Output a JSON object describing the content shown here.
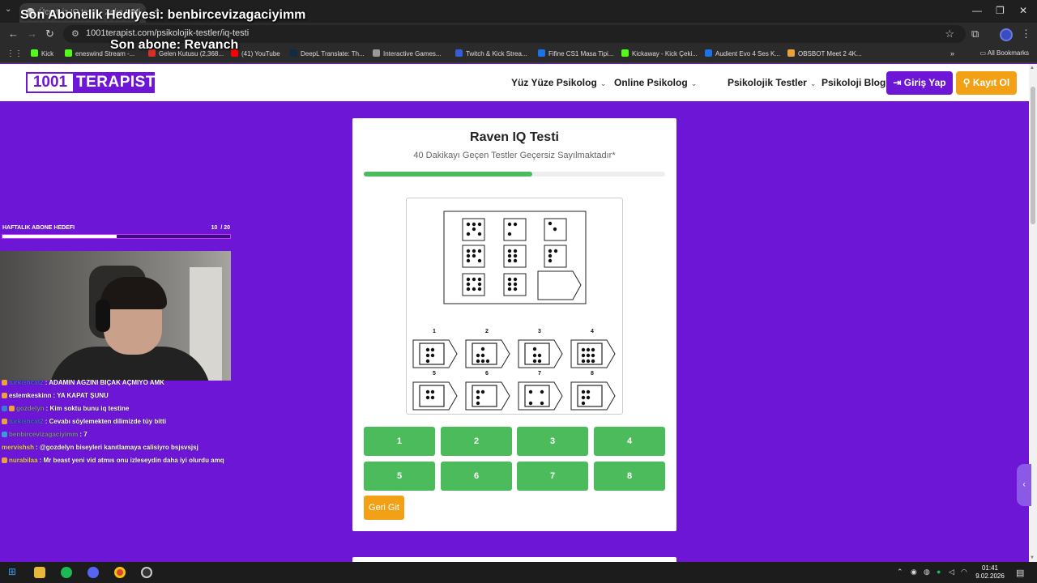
{
  "browser": {
    "tab_title": "Ücretsiz IQ testi – Zeka testi",
    "url": "1001terapist.com/psikolojik-testler/iq-testi",
    "all_bookmarks": "All Bookmarks",
    "bookmarks": [
      {
        "label": "Kick",
        "color": "#53fc18"
      },
      {
        "label": "eneswind Stream -...",
        "color": "#53fc18"
      },
      {
        "label": "Gelen Kutusu (2,368...",
        "color": "#d93025"
      },
      {
        "label": "(41) YouTube",
        "color": "#ff0000"
      },
      {
        "label": "DeepL Translate: Th...",
        "color": "#0f2b46"
      },
      {
        "label": "Interactive Games...",
        "color": "#999999"
      },
      {
        "label": "Twitch & Kick Strea...",
        "color": "#3a5bd9"
      },
      {
        "label": "Fifine CS1 Masa Tipi...",
        "color": "#1a73e8"
      },
      {
        "label": "Kickaway - Kick Çeki...",
        "color": "#53fc18"
      },
      {
        "label": "Audient Evo 4 Ses K...",
        "color": "#1a73e8"
      },
      {
        "label": "OBSBOT Meet 2 4K...",
        "color": "#e8a33d"
      }
    ]
  },
  "overlay": {
    "gift_title": "Son Abonelik Hediyesi: benbircevizagaciyimm",
    "sub_title": "Son abone: Revanch",
    "goal_label": "HAFTALIK ABONE HEDEFI",
    "goal_current": "10",
    "goal_total": "/ 20",
    "goal_progress": 0.5,
    "chat": [
      {
        "user": "turkishcat2",
        "text": ": ADAMIN AGZINI BIÇAK AÇMIYO AMK",
        "user_color": "#4a6ad9"
      },
      {
        "user": "eslemkeskinn",
        "text": ": YA KAPAT ŞUNU",
        "user_color": "#ffffff"
      },
      {
        "user": "gozdelyn",
        "text": ": Kim soktu bunu iq testine",
        "user_color": "#8a8aa0"
      },
      {
        "user": "turkishcat2",
        "text": ": Cevabı söylemekten dilimizde tüy bitti",
        "user_color": "#4a6ad9"
      },
      {
        "user": "benbircevizagaciyimm",
        "text": ": 7",
        "user_color": "#8a8aa0"
      },
      {
        "user": "mervishsh",
        "text": ": @gozdelyn biseyleri kanıtlamaya calisiyro bsjsvsjsj",
        "user_color": "#f0d060"
      },
      {
        "user": "nurabilaa",
        "text": ": Mr beast yeni vid atmıs onu izleseydin daha iyi olurdu amq",
        "user_color": "#f0d060"
      }
    ]
  },
  "site": {
    "logo_num": "1001",
    "logo_word": "TERAPIST",
    "menu": {
      "face_to_face": "Yüz Yüze Psikolog",
      "online": "Online Psikolog",
      "tests": "Psikolojik Testler",
      "blog": "Psikoloji Blog"
    },
    "login": "Giriş Yap",
    "register": "Kayıt Ol",
    "colors": {
      "brand": "#6e16d6",
      "accent": "#f2a116",
      "success": "#4cbb5c"
    }
  },
  "quiz": {
    "title": "Raven IQ Testi",
    "subtitle": "40 Dakikayı Geçen Testler Geçersiz Sayılmaktadır*",
    "progress": 0.56,
    "answers": [
      "1",
      "2",
      "3",
      "4",
      "5",
      "6",
      "7",
      "8"
    ],
    "back": "Geri Git",
    "option_labels": [
      "1",
      "2",
      "3",
      "4",
      "5",
      "6",
      "7",
      "8"
    ]
  },
  "taskbar": {
    "time": "01:41",
    "date": "9.02.2026"
  }
}
